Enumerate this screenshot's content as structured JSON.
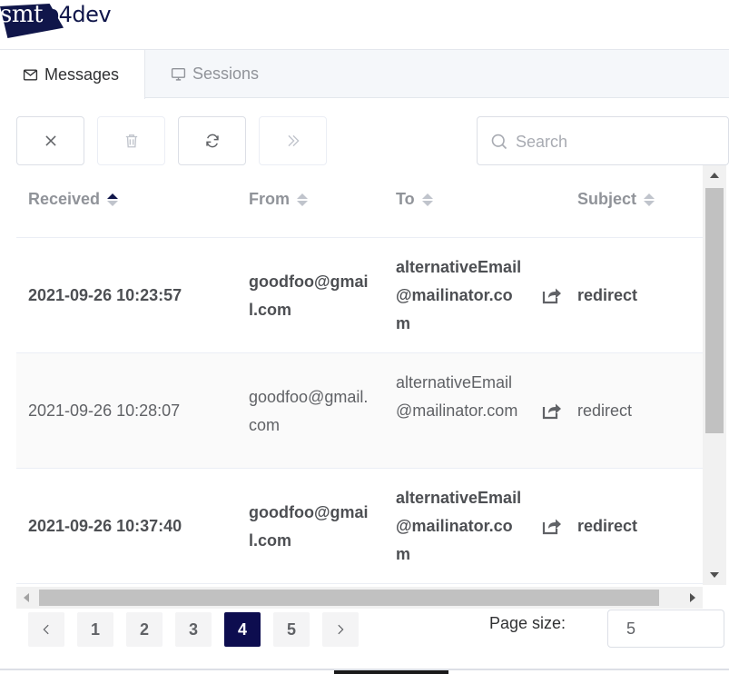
{
  "app": {
    "logo_parts": [
      "smt",
      "p",
      "4dev"
    ]
  },
  "tabs": [
    {
      "label": "Messages",
      "icon": "envelope-icon",
      "active": true
    },
    {
      "label": "Sessions",
      "icon": "monitor-icon",
      "active": false
    }
  ],
  "toolbar": {
    "buttons": [
      {
        "name": "close",
        "icon": "close-icon",
        "enabled": true
      },
      {
        "name": "delete",
        "icon": "trash-icon",
        "enabled": false
      },
      {
        "name": "refresh",
        "icon": "refresh-icon",
        "enabled": true
      },
      {
        "name": "relay",
        "icon": "double-chevron-right-icon",
        "enabled": false
      }
    ],
    "search_placeholder": "Search",
    "search_value": ""
  },
  "table": {
    "columns": [
      {
        "label": "Received",
        "sort": "ascending"
      },
      {
        "label": "From",
        "sort": "none"
      },
      {
        "label": "To",
        "sort": "none"
      },
      {
        "label": "Subject",
        "sort": "none"
      }
    ],
    "rows": [
      {
        "received": "2021-09-26 10:23:57",
        "from": "goodfoo@gmail.com",
        "to": "alternativeEmail@mailinator.com",
        "relay_icon": "share-icon",
        "subject": "redirect",
        "unread": true
      },
      {
        "received": "2021-09-26 10:28:07",
        "from": "goodfoo@gmail.com",
        "to": "alternativeEmail@mailinator.com",
        "relay_icon": "share-icon",
        "subject": "redirect",
        "unread": false
      },
      {
        "received": "2021-09-26 10:37:40",
        "from": "goodfoo@gmail.com",
        "to": "alternativeEmail@mailinator.com",
        "relay_icon": "share-icon",
        "subject": "redirect",
        "unread": true
      }
    ]
  },
  "pagination": {
    "pages": [
      "1",
      "2",
      "3",
      "4",
      "5"
    ],
    "current": "4",
    "page_size_label": "Page size:",
    "page_size_value": "5"
  },
  "colors": {
    "brand": "#10164a",
    "active_page": "#0d0d4f",
    "muted_text": "#909399"
  }
}
